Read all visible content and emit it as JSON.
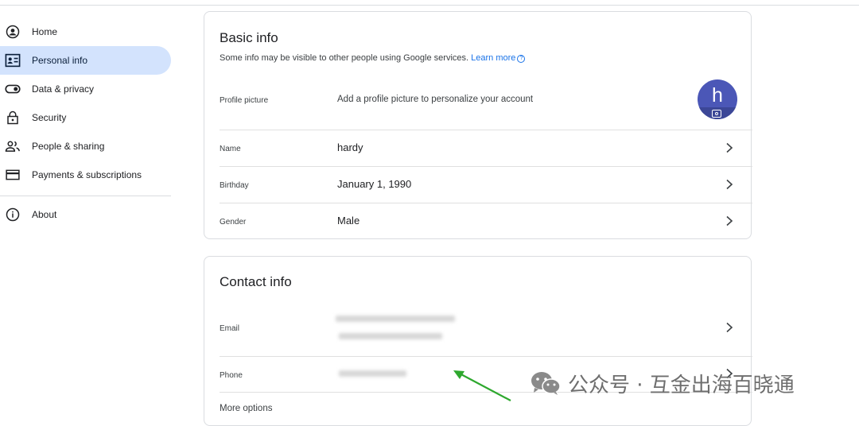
{
  "sidebar": {
    "items": [
      {
        "label": "Home",
        "icon": "person-circle-icon",
        "active": false
      },
      {
        "label": "Personal info",
        "icon": "id-card-icon",
        "active": true
      },
      {
        "label": "Data & privacy",
        "icon": "toggle-icon",
        "active": false
      },
      {
        "label": "Security",
        "icon": "lock-icon",
        "active": false
      },
      {
        "label": "People & sharing",
        "icon": "people-icon",
        "active": false
      },
      {
        "label": "Payments & subscriptions",
        "icon": "credit-card-icon",
        "active": false
      }
    ],
    "about": {
      "label": "About",
      "icon": "info-icon"
    }
  },
  "basic_info": {
    "title": "Basic info",
    "subtitle": "Some info may be visible to other people using Google services.",
    "learn_more": "Learn more",
    "profile_picture": {
      "label": "Profile picture",
      "value": "Add a profile picture to personalize your account",
      "avatar_letter": "h"
    },
    "name": {
      "label": "Name",
      "value": "hardy"
    },
    "birthday": {
      "label": "Birthday",
      "value": "January 1, 1990"
    },
    "gender": {
      "label": "Gender",
      "value": "Male"
    }
  },
  "contact_info": {
    "title": "Contact info",
    "email": {
      "label": "Email"
    },
    "phone": {
      "label": "Phone"
    },
    "more_options": "More options"
  },
  "watermark": {
    "text": "公众号 · 互金出海百晓通"
  },
  "colors": {
    "accent": "#1a73e8",
    "active_nav_bg": "#d3e3fd",
    "avatar_bg": "#4b57b7",
    "arrow": "#2ea82e"
  }
}
